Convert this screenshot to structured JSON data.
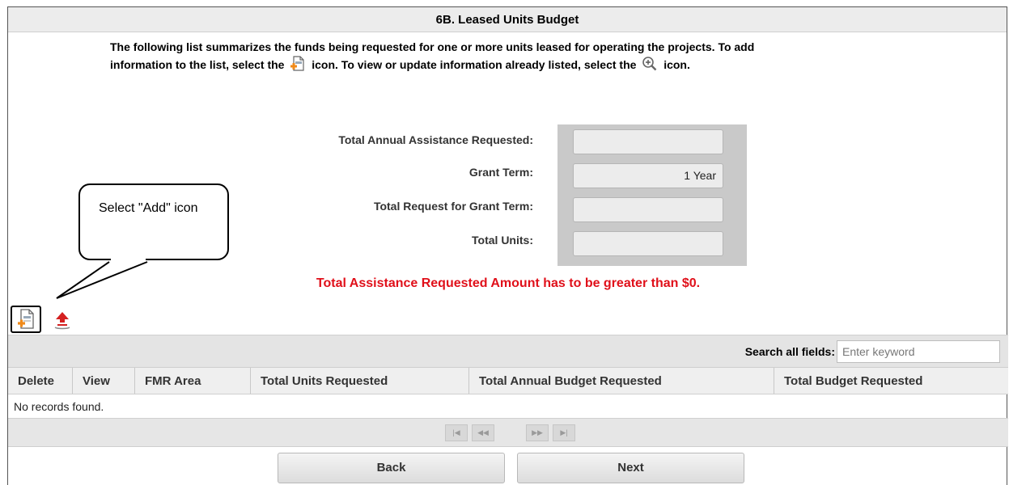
{
  "page": {
    "title": "6B. Leased Units Budget",
    "instructions": {
      "line1": "The following list summarizes the funds being requested for one or more units leased for operating the projects. To add",
      "line2_part1": "information to the list, select the",
      "line2_part2": "icon. To view or update information already listed, select the",
      "line2_part3": "icon."
    }
  },
  "summary": {
    "fields": [
      {
        "label": "Total Annual Assistance Requested:",
        "value": ""
      },
      {
        "label": "Grant Term:",
        "value": "1 Year"
      },
      {
        "label": "Total Request for Grant Term:",
        "value": ""
      },
      {
        "label": "Total Units:",
        "value": ""
      }
    ]
  },
  "error_message": "Total Assistance Requested Amount has to be greater than $0.",
  "callout": {
    "text": "Select \"Add\" icon"
  },
  "toolbar": {
    "add_icon": "add-document-icon",
    "upload_icon": "upload-icon"
  },
  "search": {
    "label": "Search all fields:",
    "placeholder": "Enter keyword"
  },
  "grid": {
    "columns": [
      "Delete",
      "View",
      "FMR Area",
      "Total Units Requested",
      "Total Annual Budget Requested",
      "Total Budget Requested"
    ],
    "empty_message": "No records found."
  },
  "pager": {
    "first": "|◀",
    "prev": "◀◀",
    "next": "▶▶",
    "last": "▶|"
  },
  "buttons": {
    "back": "Back",
    "next": "Next"
  },
  "colors": {
    "error": "#e0101a",
    "panel": "#c9c9c9",
    "title_bar": "#ececec"
  }
}
